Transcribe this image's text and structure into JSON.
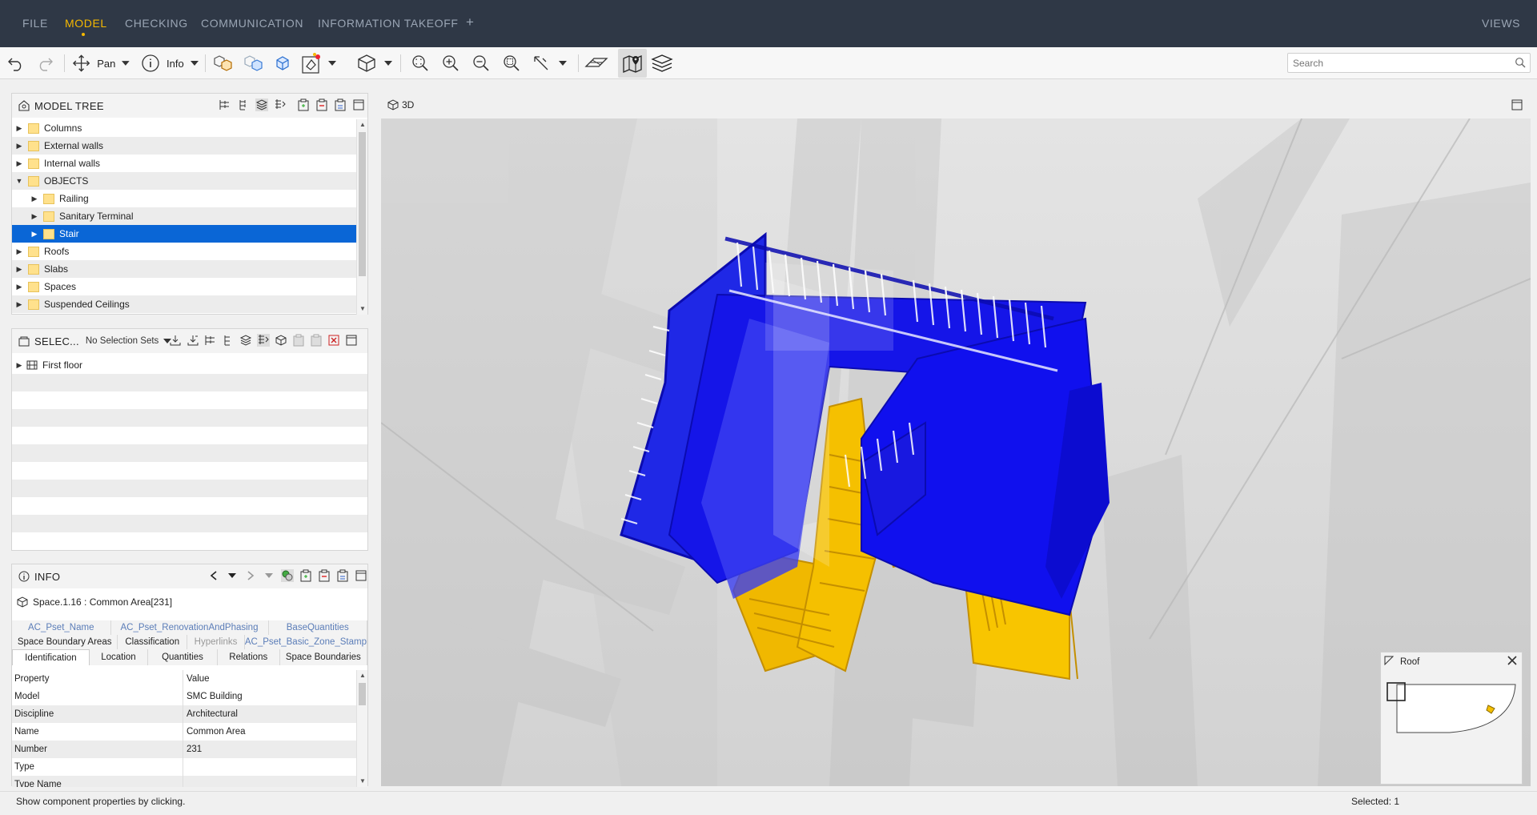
{
  "menu": {
    "items": [
      "FILE",
      "MODEL",
      "CHECKING",
      "COMMUNICATION",
      "INFORMATION TAKEOFF"
    ],
    "active": "MODEL",
    "add": "+",
    "views": "VIEWS"
  },
  "toolbar": {
    "pan_label": "Pan",
    "info_label": "Info",
    "search_placeholder": "Search"
  },
  "model_tree": {
    "title": "MODEL TREE",
    "rows": [
      {
        "label": "Columns",
        "expanded": false,
        "level": 0
      },
      {
        "label": "External walls",
        "expanded": false,
        "level": 0
      },
      {
        "label": "Internal walls",
        "expanded": false,
        "level": 0
      },
      {
        "label": "OBJECTS",
        "expanded": true,
        "level": 0
      },
      {
        "label": "Railing",
        "expanded": false,
        "level": 1
      },
      {
        "label": "Sanitary Terminal",
        "expanded": false,
        "level": 1
      },
      {
        "label": "Stair",
        "expanded": false,
        "level": 1,
        "selected": true
      },
      {
        "label": "Roofs",
        "expanded": false,
        "level": 0
      },
      {
        "label": "Slabs",
        "expanded": false,
        "level": 0
      },
      {
        "label": "Spaces",
        "expanded": false,
        "level": 0
      },
      {
        "label": "Suspended Ceilings",
        "expanded": false,
        "level": 0
      }
    ]
  },
  "selection_sets": {
    "title": "SELEC...",
    "dropdown": "No Selection Sets",
    "rows": [
      "First floor"
    ]
  },
  "info": {
    "title": "INFO",
    "object": "Space.1.16 : Common Area[231]",
    "tabs_row1": [
      "AC_Pset_Name",
      "AC_Pset_RenovationAndPhasing",
      "BaseQuantities"
    ],
    "tabs_row2": [
      "Space Boundary Areas",
      "Classification",
      "Hyperlinks",
      "AC_Pset_Basic_Zone_Stamp"
    ],
    "tabs_row3": [
      "Identification",
      "Location",
      "Quantities",
      "Relations",
      "Space Boundaries"
    ],
    "active_tab": "Identification",
    "columns": [
      "Property",
      "Value"
    ],
    "rows": [
      {
        "k": "Model",
        "v": "SMC Building"
      },
      {
        "k": "Discipline",
        "v": "Architectural"
      },
      {
        "k": "Name",
        "v": "Common Area"
      },
      {
        "k": "Number",
        "v": "231"
      },
      {
        "k": "Type",
        "v": ""
      },
      {
        "k": "Type Name",
        "v": ""
      }
    ]
  },
  "view": {
    "title": "3D",
    "minimap_title": "Roof"
  },
  "status": {
    "hint": "Show component properties by clicking.",
    "selected": "Selected: 1"
  },
  "colors": {
    "menubar": "#2f3846",
    "accent": "#f5b800",
    "selection": "#0a66d6",
    "stair_blue": "#1010e0",
    "stair_yellow": "#f5c000"
  }
}
